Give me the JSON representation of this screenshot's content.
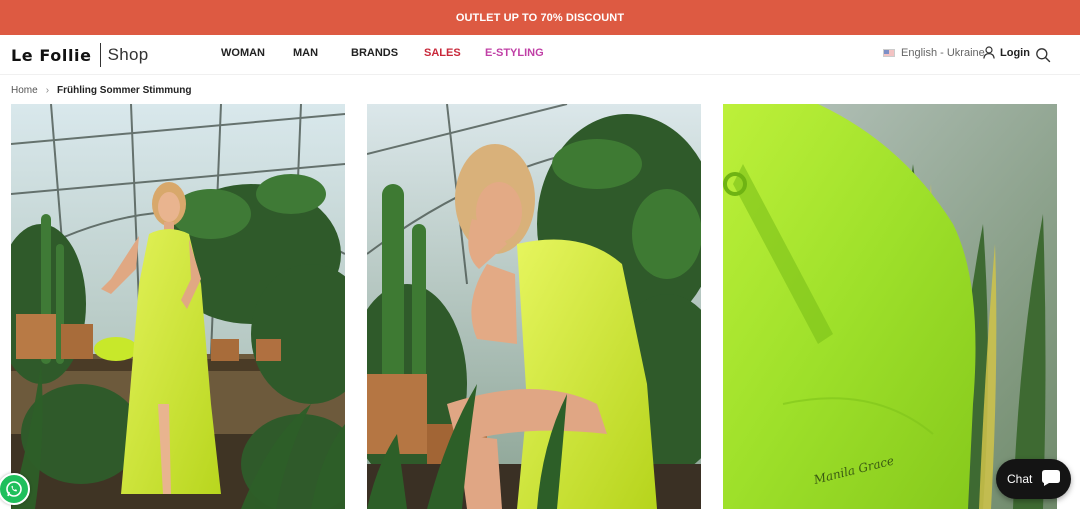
{
  "promo": {
    "text": "OUTLET UP TO 70% DISCOUNT"
  },
  "header": {
    "logo_main": "Le Follie",
    "logo_sub": "Shop",
    "nav": [
      "WOMAN",
      "MAN",
      "BRANDS",
      "SALES",
      "E-STYLING"
    ],
    "language": "English - Ukraine",
    "login": "Login"
  },
  "breadcrumb": {
    "home": "Home",
    "separator": "›",
    "current": "Frühling Sommer Stimmung"
  },
  "products": [
    {
      "image": "model in lime green wrap maxi dress standing in greenhouse"
    },
    {
      "image": "model in lime green wrap dress seated among cacti"
    },
    {
      "image": "close-up of lime green leather bag among plants"
    }
  ],
  "bag_signature": "Manila Grace",
  "chat": {
    "label": "Chat"
  },
  "icons": {
    "user": "user-icon",
    "search": "search-icon",
    "whatsapp": "whatsapp-icon",
    "chat": "chat-bubble-icon",
    "flag": "flag-icon"
  },
  "colors": {
    "promo_bar": "#dd5a42",
    "sales": "#c8283a",
    "styling": "#c03fa6",
    "lime": "#c8e82a"
  }
}
